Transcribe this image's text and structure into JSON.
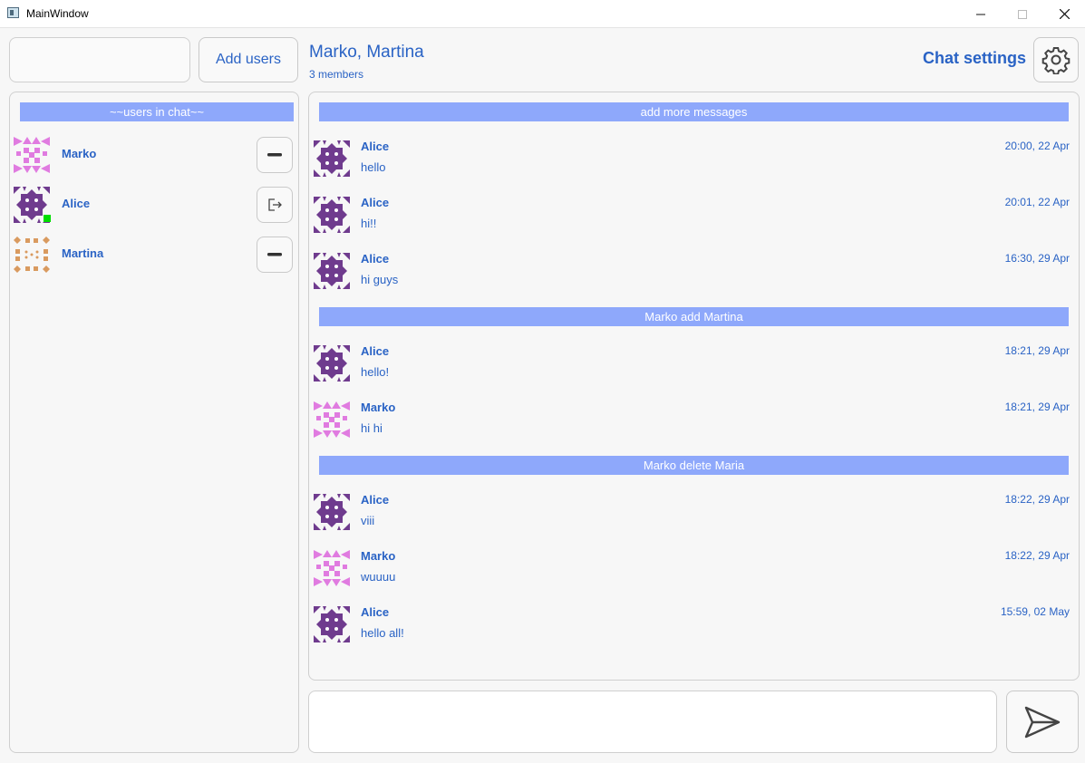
{
  "window": {
    "title": "MainWindow"
  },
  "top": {
    "add_users_label": "Add users",
    "search_value": ""
  },
  "chat": {
    "title": "Marko, Martina",
    "members_text": "3 members",
    "settings_label": "Chat settings"
  },
  "members_panel": {
    "header": "~~users in chat~~",
    "members": [
      {
        "name": "Marko",
        "avatar": "pink-identicon",
        "action": "remove-icon",
        "online": false
      },
      {
        "name": "Alice",
        "avatar": "purple-identicon",
        "action": "leave-icon",
        "online": true
      },
      {
        "name": "Martina",
        "avatar": "tan-identicon",
        "action": "remove-icon",
        "online": false
      }
    ]
  },
  "messages": [
    {
      "kind": "banner",
      "text": "add more messages"
    },
    {
      "kind": "message",
      "author": "Alice",
      "text": "hello",
      "time": "20:00, 22 Apr",
      "avatar": "purple-identicon"
    },
    {
      "kind": "message",
      "author": "Alice",
      "text": "hi!!",
      "time": "20:01, 22 Apr",
      "avatar": "purple-identicon"
    },
    {
      "kind": "message",
      "author": "Alice",
      "text": "hi guys",
      "time": "16:30, 29 Apr",
      "avatar": "purple-identicon"
    },
    {
      "kind": "banner",
      "text": "Marko add Martina"
    },
    {
      "kind": "message",
      "author": "Alice",
      "text": "hello!",
      "time": "18:21, 29 Apr",
      "avatar": "purple-identicon"
    },
    {
      "kind": "message",
      "author": "Marko",
      "text": "hi hi",
      "time": "18:21, 29 Apr",
      "avatar": "pink-identicon"
    },
    {
      "kind": "banner",
      "text": "Marko delete Maria"
    },
    {
      "kind": "message",
      "author": "Alice",
      "text": "viii",
      "time": "18:22, 29 Apr",
      "avatar": "purple-identicon"
    },
    {
      "kind": "message",
      "author": "Marko",
      "text": "wuuuu",
      "time": "18:22, 29 Apr",
      "avatar": "pink-identicon"
    },
    {
      "kind": "message",
      "author": "Alice",
      "text": "hello all!",
      "time": "15:59, 02 May",
      "avatar": "purple-identicon"
    }
  ],
  "composer": {
    "value": "",
    "send_icon": "send-icon"
  },
  "colors": {
    "accent": "#2a63c5",
    "banner": "#8ea8fb",
    "online": "#00dd00",
    "avatar_purple": "#6f3b8e",
    "avatar_pink": "#e07be0",
    "avatar_tan": "#d99a5f"
  }
}
